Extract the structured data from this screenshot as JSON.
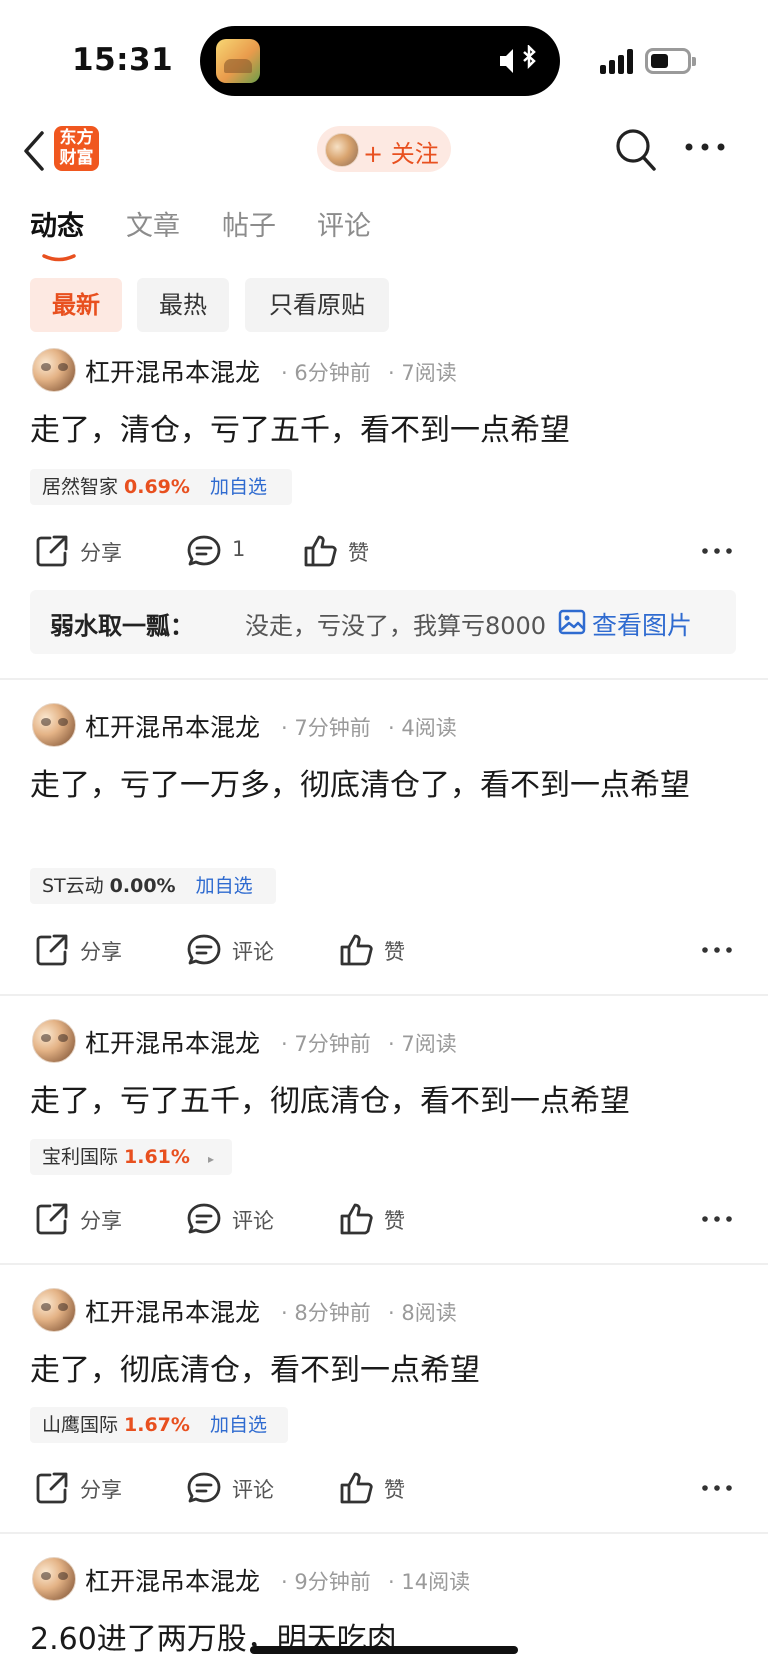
{
  "status_bar": {
    "time": "15:31"
  },
  "nav": {
    "logo_text": "东方财富",
    "follow_label": "+ 关注"
  },
  "tabs": [
    {
      "label": "动态",
      "active": true
    },
    {
      "label": "文章",
      "active": false
    },
    {
      "label": "帖子",
      "active": false
    },
    {
      "label": "评论",
      "active": false
    }
  ],
  "filters": [
    {
      "label": "最新",
      "active": true
    },
    {
      "label": "最热",
      "active": false
    },
    {
      "label": "只看原贴",
      "active": false
    }
  ],
  "actions": {
    "share": "分享",
    "comment": "评论",
    "like": "赞"
  },
  "posts": [
    {
      "author": "杠开混吊本混龙",
      "time": "6分钟前",
      "reads": "7阅读",
      "content": "走了，清仓，亏了五千，看不到一点希望",
      "stock": {
        "name": "居然智家",
        "change": "0.69%",
        "action": "加自选"
      },
      "comment_count": "1",
      "reply": {
        "name": "弱水取一瓢",
        "text": "没走，亏没了，我算亏8000",
        "link": "查看图片"
      }
    },
    {
      "author": "杠开混吊本混龙",
      "time": "7分钟前",
      "reads": "4阅读",
      "content": "走了，亏了一万多，彻底清仓了，看不到一点希望",
      "stock": {
        "name": "ST云动",
        "change": "0.00%",
        "action": "加自选"
      }
    },
    {
      "author": "杠开混吊本混龙",
      "time": "7分钟前",
      "reads": "7阅读",
      "content": "走了，亏了五千，彻底清仓，看不到一点希望",
      "stock": {
        "name": "宝利国际",
        "change": "1.61%",
        "action": "▸"
      }
    },
    {
      "author": "杠开混吊本混龙",
      "time": "8分钟前",
      "reads": "8阅读",
      "content": "走了，彻底清仓，看不到一点希望",
      "stock": {
        "name": "山鹰国际",
        "change": "1.67%",
        "action": "加自选"
      }
    },
    {
      "author": "杠开混吊本混龙",
      "time": "9分钟前",
      "reads": "14阅读",
      "content": "2.60进了两万股，明天吃肉"
    }
  ],
  "colors": {
    "accent": "#e8501f",
    "link": "#2f6bd0",
    "logo": "#f0571f"
  }
}
